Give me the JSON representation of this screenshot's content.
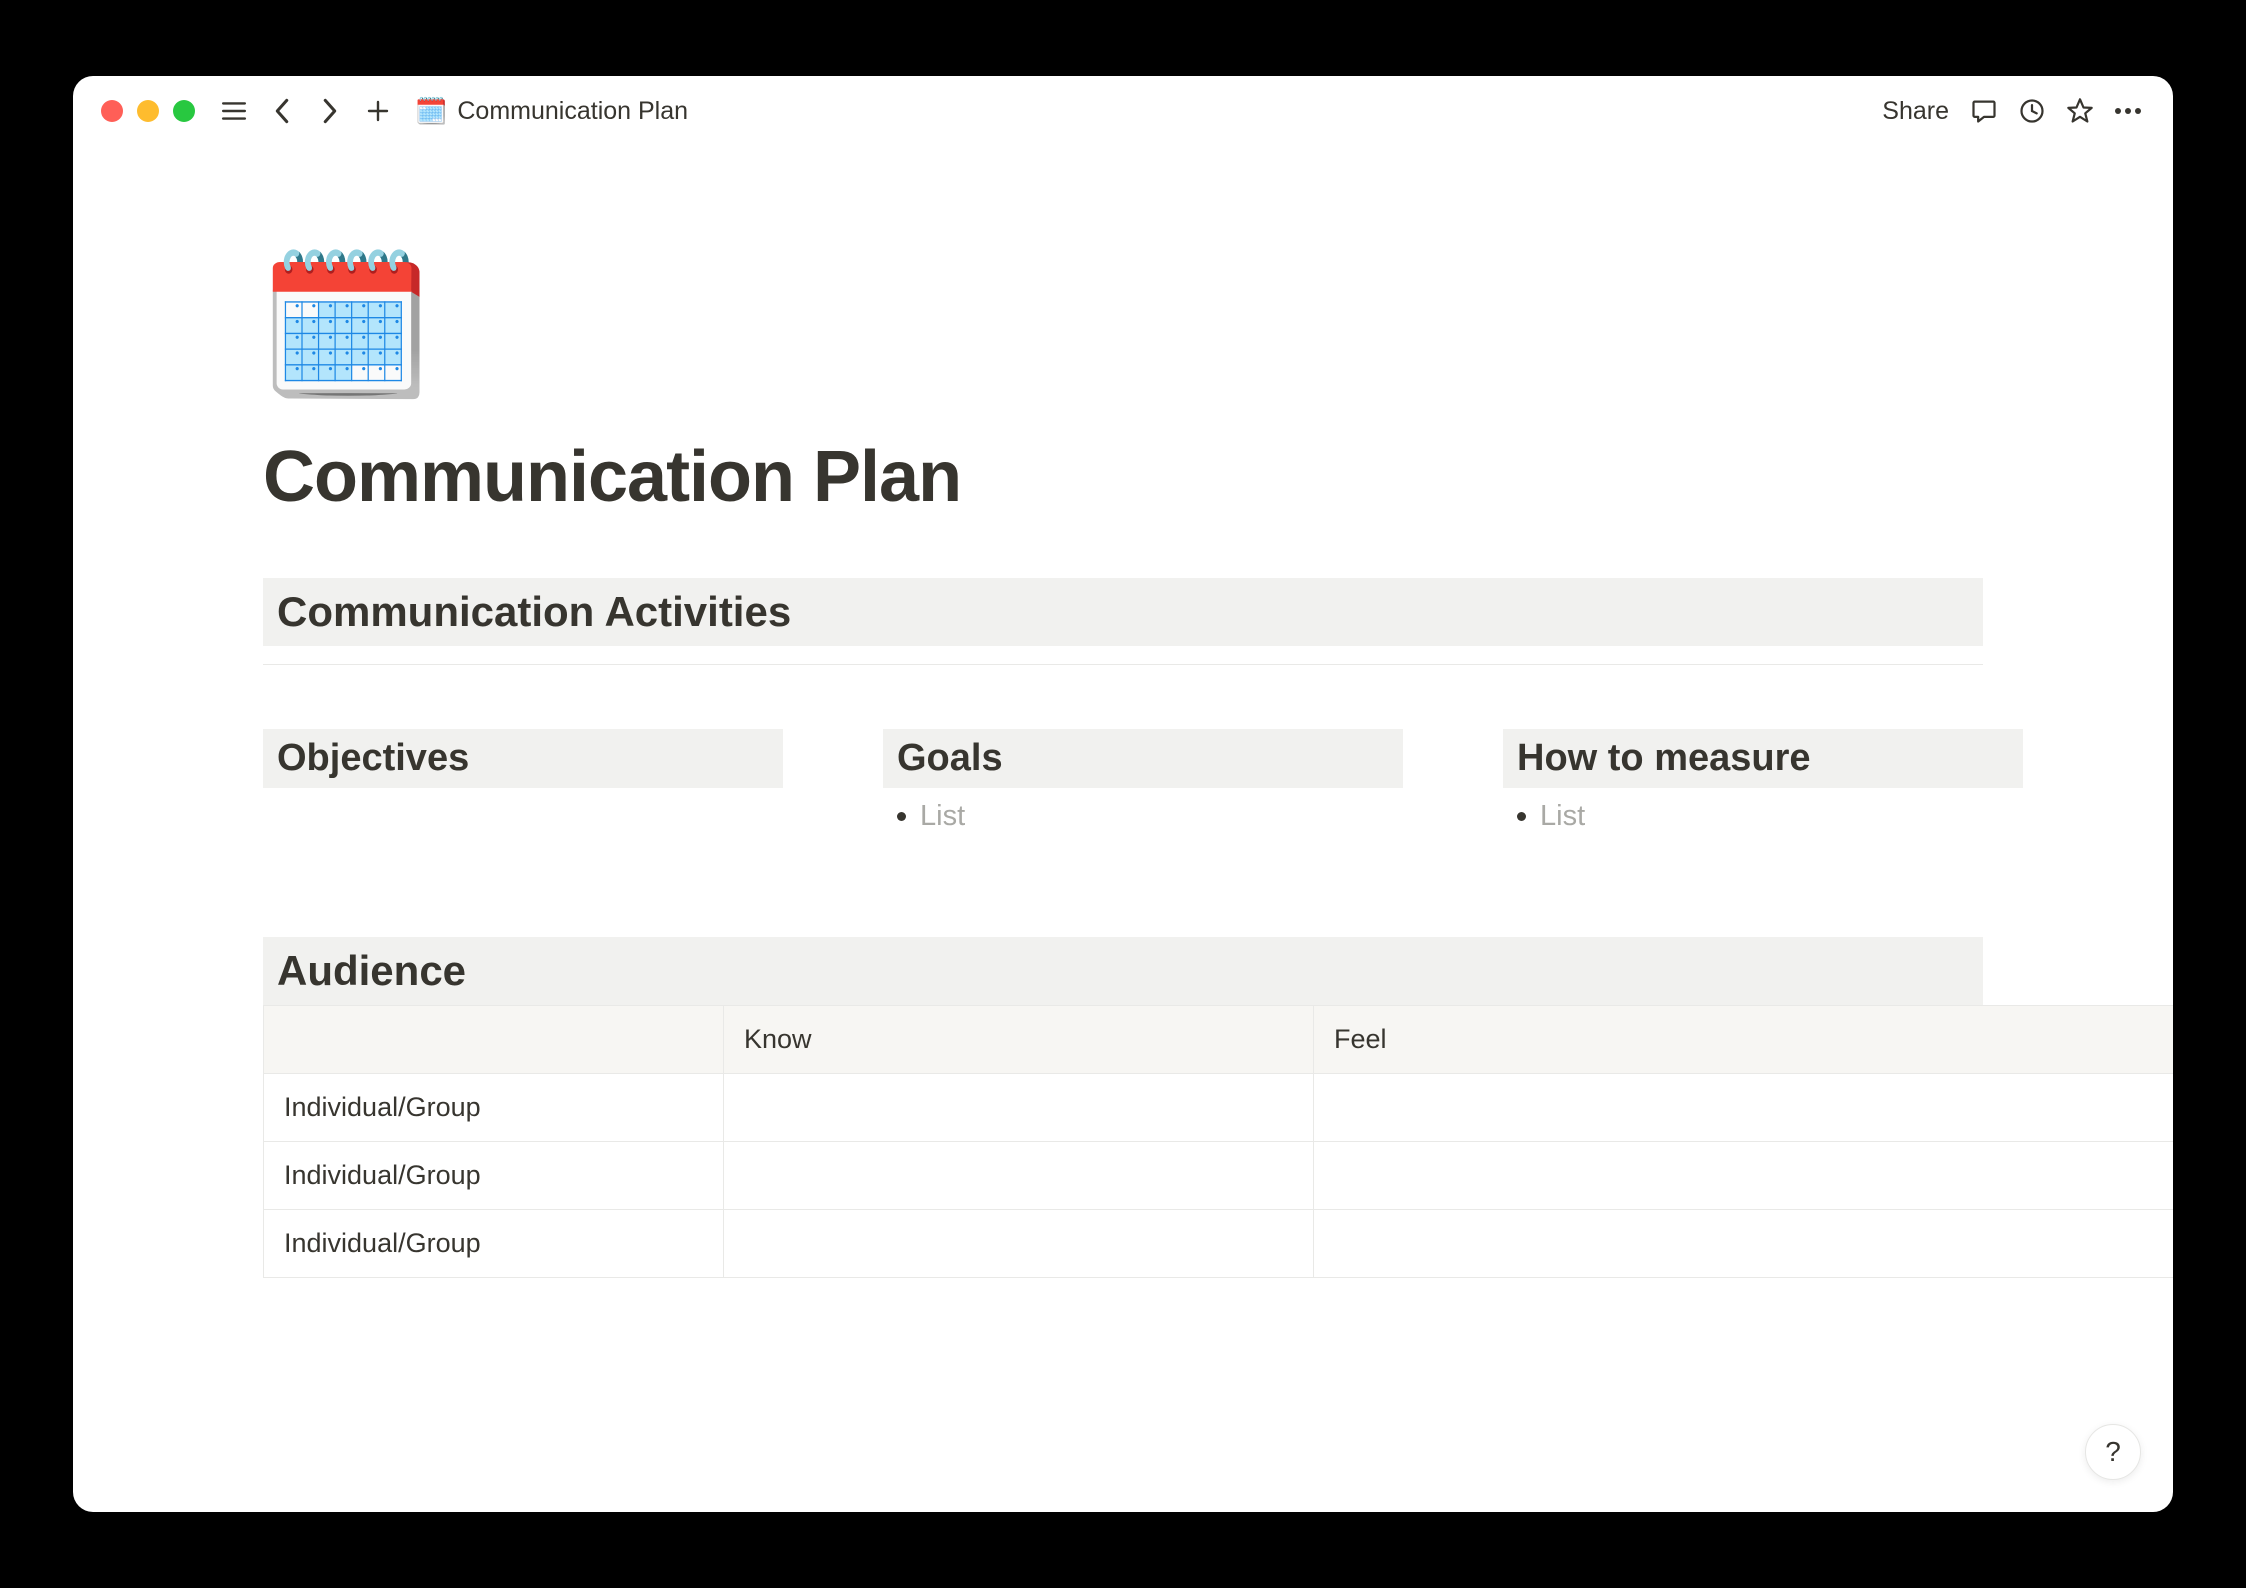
{
  "toolbar": {
    "breadcrumb_icon": "🗓️",
    "breadcrumb_title": "Communication Plan",
    "share_label": "Share"
  },
  "page": {
    "icon": "🗓️",
    "title": "Communication Plan"
  },
  "sections": {
    "activities_heading": "Communication Activities",
    "objectives_heading": "Objectives",
    "goals_heading": "Goals",
    "goals_bullet_placeholder": "List",
    "measure_heading": "How to measure",
    "measure_bullet_placeholder": "List",
    "audience_heading": "Audience"
  },
  "audience_table": {
    "headers": [
      "",
      "Know",
      "Feel"
    ],
    "rows": [
      [
        "Individual/Group",
        "",
        ""
      ],
      [
        "Individual/Group",
        "",
        ""
      ],
      [
        "Individual/Group",
        "",
        ""
      ]
    ]
  },
  "help_label": "?"
}
